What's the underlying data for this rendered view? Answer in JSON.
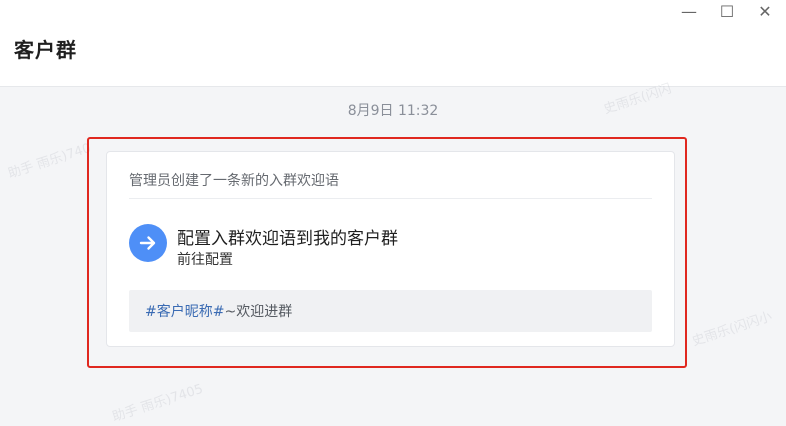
{
  "window": {
    "controls": {
      "minimize": "—",
      "maximize": "☐",
      "close": "✕"
    }
  },
  "header": {
    "title": "客户群"
  },
  "chat": {
    "timestamp": "8月9日 11:32",
    "card": {
      "notice": "管理员创建了一条新的入群欢迎语",
      "action_icon": "arrow-right-icon",
      "action_title": "配置入群欢迎语到我的客户群",
      "action_subtitle": "前往配置",
      "preview": {
        "tag": "#客户昵称#",
        "text": "~欢迎进群"
      }
    }
  },
  "watermarks": [
    "史雨乐(闪闪",
    "助手 雨乐)740",
    "史雨乐(闪闪小",
    "助手 雨乐)7405"
  ],
  "colors": {
    "highlight": "#e0281f",
    "accent": "#4e8ff7",
    "tag": "#3a6bb3"
  }
}
